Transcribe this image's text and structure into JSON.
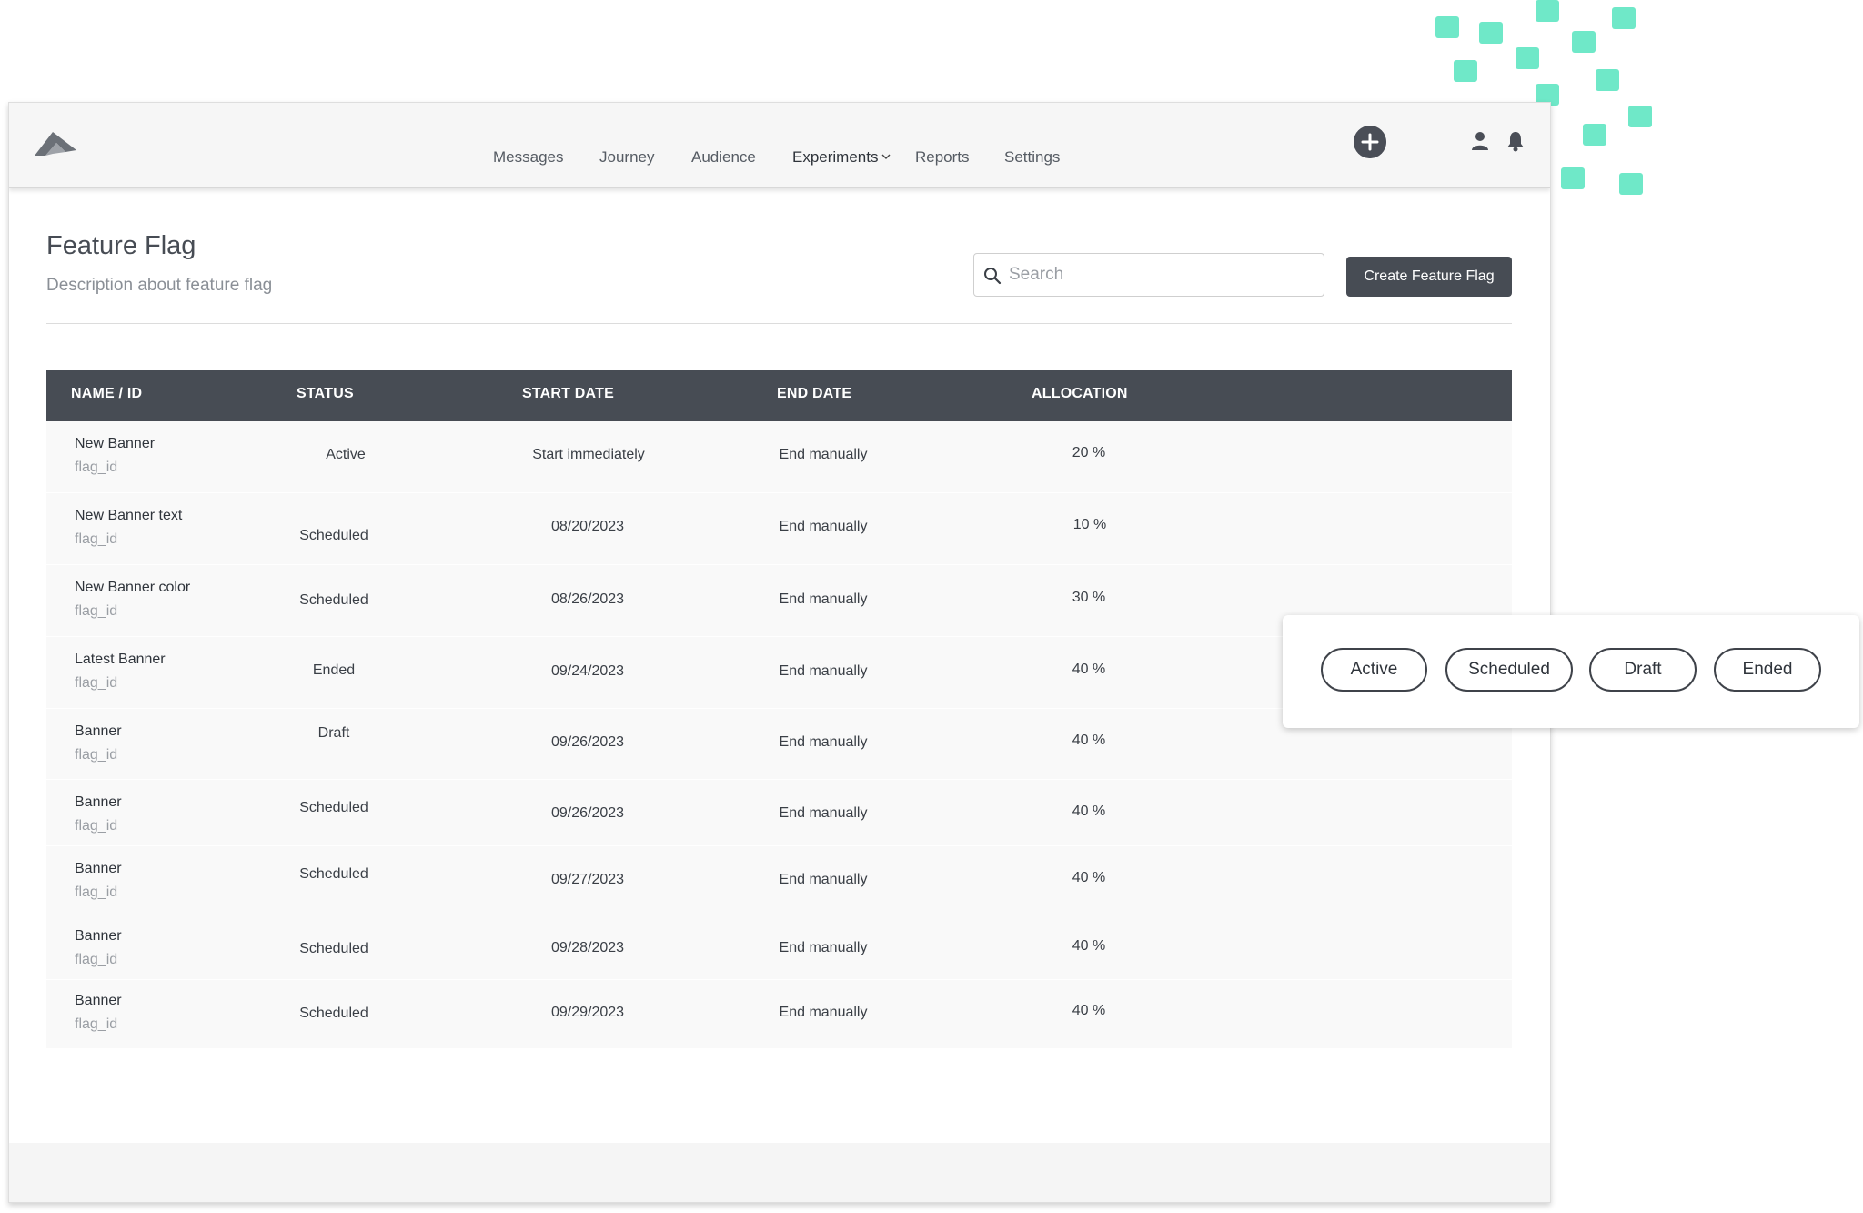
{
  "colors": {
    "accent_dark": "#474c54",
    "decoration_mint": "#6fe8c8",
    "page_background": "#ffffff",
    "row_background": "#f9f9f9"
  },
  "topbar": {
    "logo_icon": "mountain-logo-icon",
    "nav": [
      {
        "label": "Messages"
      },
      {
        "label": "Journey"
      },
      {
        "label": "Audience"
      },
      {
        "label": "Experiments",
        "active": true,
        "has_dropdown": true
      },
      {
        "label": "Reports"
      },
      {
        "label": "Settings"
      }
    ],
    "icons": [
      "plus-circle-icon",
      "user-icon",
      "bell-icon"
    ]
  },
  "page": {
    "title": "Feature Flag",
    "description": "Description about feature flag",
    "search_placeholder": "Search",
    "create_button_label": "Create Feature Flag"
  },
  "table": {
    "columns": [
      "NAME / ID",
      "STATUS",
      "START DATE",
      "END DATE",
      "ALLOCATION"
    ],
    "rows": [
      {
        "name": "New Banner",
        "id": "flag_id",
        "status": "Active",
        "start": "Start immediately",
        "end": "End manually",
        "allocation": "20 %"
      },
      {
        "name": "New Banner text",
        "id": "flag_id",
        "status": "Scheduled",
        "start": "08/20/2023",
        "end": "End manually",
        "allocation": "10 %"
      },
      {
        "name": "New Banner color",
        "id": "flag_id",
        "status": "Scheduled",
        "start": "08/26/2023",
        "end": "End manually",
        "allocation": "30 %"
      },
      {
        "name": "Latest Banner",
        "id": "flag_id",
        "status": "Ended",
        "start": "09/24/2023",
        "end": "End manually",
        "allocation": "40 %"
      },
      {
        "name": "Banner",
        "id": "flag_id",
        "status": "Draft",
        "start": "09/26/2023",
        "end": "End manually",
        "allocation": "40 %"
      },
      {
        "name": "Banner",
        "id": "flag_id",
        "status": "Scheduled",
        "start": "09/26/2023",
        "end": "End manually",
        "allocation": "40 %"
      },
      {
        "name": "Banner",
        "id": "flag_id",
        "status": "Scheduled",
        "start": "09/27/2023",
        "end": "End manually",
        "allocation": "40 %"
      },
      {
        "name": "Banner",
        "id": "flag_id",
        "status": "Scheduled",
        "start": "09/28/2023",
        "end": "End manually",
        "allocation": "40 %"
      },
      {
        "name": "Banner",
        "id": "flag_id",
        "status": "Scheduled",
        "start": "09/29/2023",
        "end": "End manually",
        "allocation": "40 %"
      }
    ]
  },
  "status_filters": [
    "Active",
    "Scheduled",
    "Draft",
    "Ended"
  ]
}
